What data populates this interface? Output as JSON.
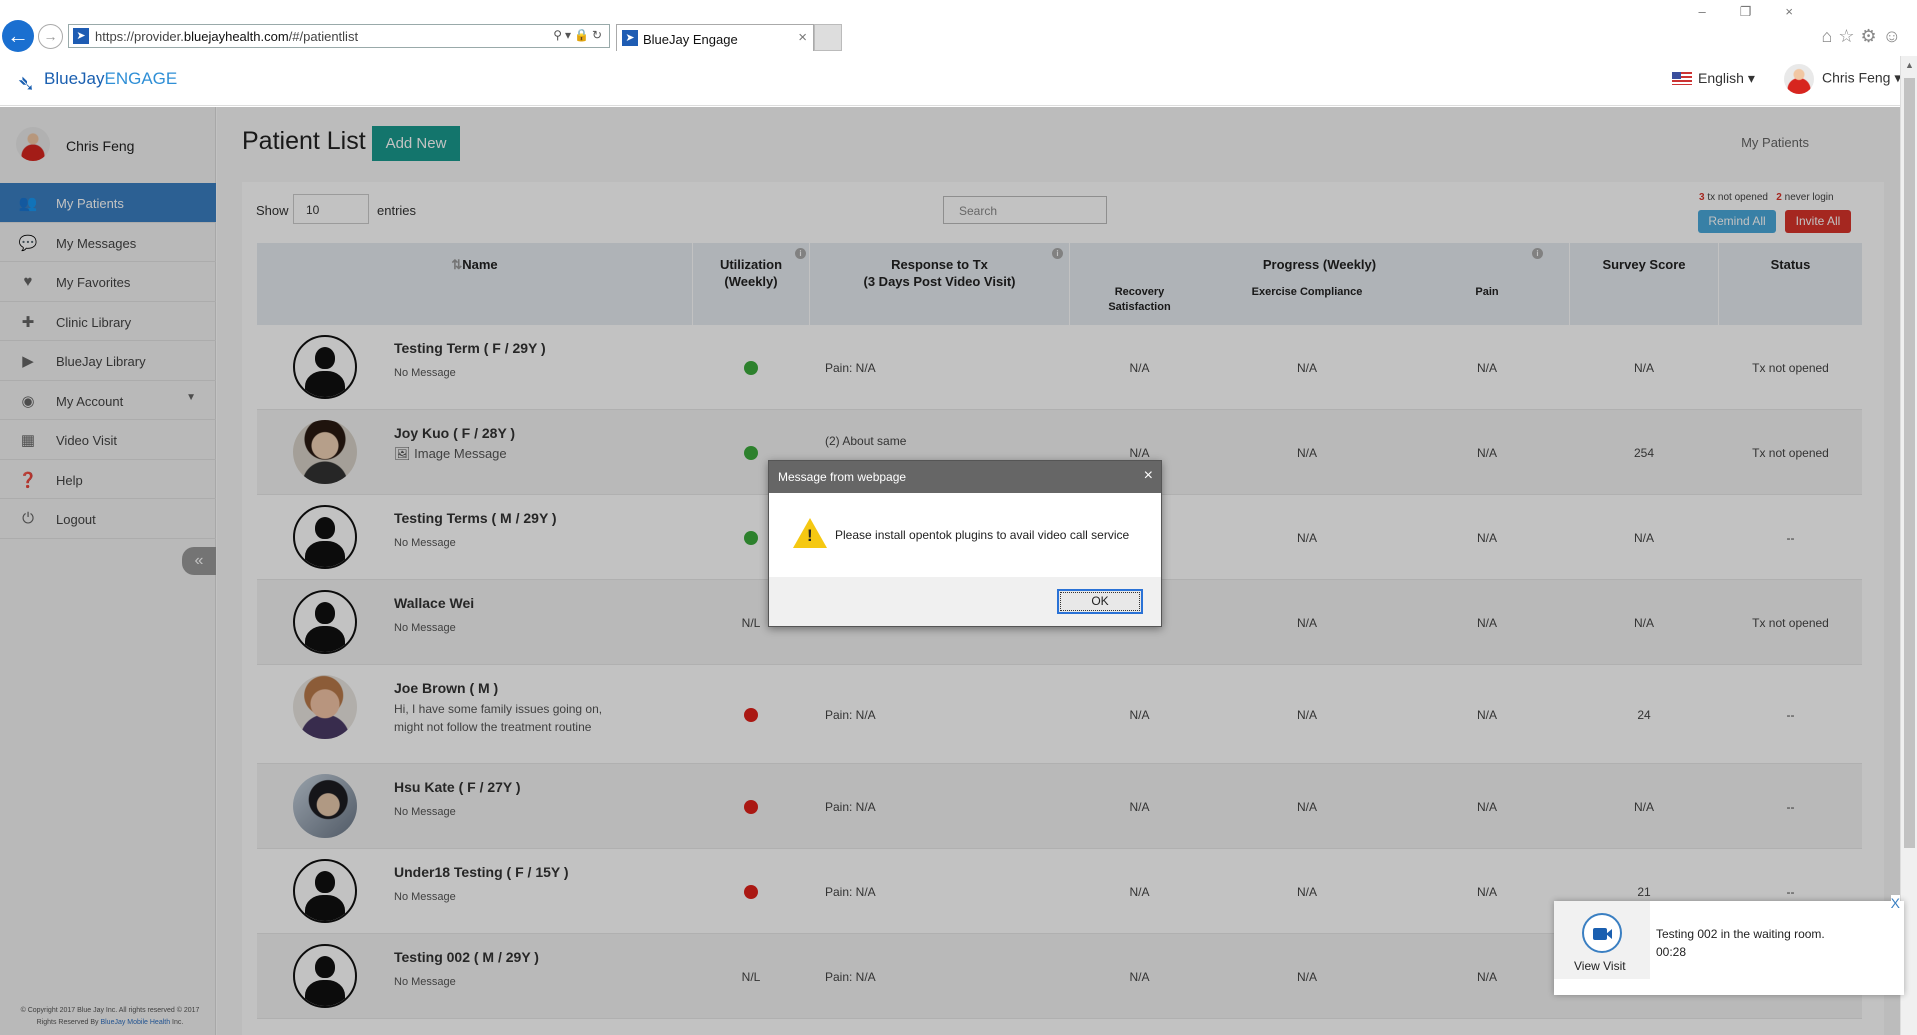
{
  "browser": {
    "url_prefix": "https://provider.",
    "url_domain": "bluejayhealth.com",
    "url_suffix": "/#/patientlist",
    "tab_title": "BlueJay Engage"
  },
  "header": {
    "logo_brand": "BlueJay",
    "logo_product": "ENGAGE",
    "language": "English",
    "user_name": "Chris Feng"
  },
  "sidebar": {
    "user_name": "Chris Feng",
    "items": [
      {
        "label": "My Patients",
        "icon": "users-icon"
      },
      {
        "label": "My Messages",
        "icon": "chat-icon"
      },
      {
        "label": "My Favorites",
        "icon": "heart-icon"
      },
      {
        "label": "Clinic Library",
        "icon": "medical-bag-icon"
      },
      {
        "label": "BlueJay Library",
        "icon": "play-icon"
      },
      {
        "label": "My Account",
        "icon": "account-icon"
      },
      {
        "label": "Video Visit",
        "icon": "calendar-icon"
      },
      {
        "label": "Help",
        "icon": "help-icon"
      },
      {
        "label": "Logout",
        "icon": "power-icon"
      }
    ],
    "collapse_glyph": "«",
    "copyright_line1": "© Copyright 2017 Blue Jay Inc. All rights reserved © 2017",
    "copyright_line2_pre": "Rights Reserved By ",
    "copyright_link": "BlueJay Mobile Health",
    "copyright_line2_post": " Inc."
  },
  "main": {
    "title": "Patient List",
    "add_new": "Add New",
    "breadcrumb": "My Patients",
    "show_label": "Show",
    "show_value": "10",
    "entries_label": "entries",
    "search_placeholder": "Search",
    "tx_count": "3",
    "tx_label": " tx not opened",
    "login_count": "2",
    "login_label": " never login",
    "remind_all": "Remind All",
    "invite_all": "Invite All"
  },
  "table": {
    "headers": {
      "name": "Name",
      "utilization_1": "Utilization",
      "utilization_2": "(Weekly)",
      "response_1": "Response to Tx",
      "response_2": "(3 Days Post Video Visit)",
      "progress": "Progress (Weekly)",
      "recovery_1": "Recovery",
      "recovery_2": "Satisfaction",
      "exercise": "Exercise Compliance",
      "pain": "Pain",
      "survey": "Survey Score",
      "status": "Status"
    },
    "rows": [
      {
        "name": "Testing Term ( F / 29Y )",
        "msg": "No Message",
        "util": "green",
        "response": "Pain: N/A",
        "recovery": "N/A",
        "exercise": "N/A",
        "pain": "N/A",
        "survey": "N/A",
        "status": "Tx not opened"
      },
      {
        "name": "Joy Kuo ( F / 28Y )",
        "msg": "Image Message",
        "util": "green",
        "response": "(2) About same",
        "recovery": "N/A",
        "exercise": "N/A",
        "pain": "N/A",
        "survey": "254",
        "status": "Tx not opened"
      },
      {
        "name": "Testing Terms ( M / 29Y )",
        "msg": "No Message",
        "util": "green",
        "response": "",
        "recovery": "",
        "exercise": "N/A",
        "pain": "N/A",
        "survey": "N/A",
        "status": "--"
      },
      {
        "name": "Wallace Wei",
        "msg": "No Message",
        "util": "N/L",
        "response": "",
        "recovery": "",
        "exercise": "N/A",
        "pain": "N/A",
        "survey": "N/A",
        "status": "Tx not opened"
      },
      {
        "name": "Joe Brown ( M )",
        "msg": "Hi, I have some family issues going on, might not follow the treatment routine",
        "util": "red",
        "response": "Pain: N/A",
        "recovery": "N/A",
        "exercise": "N/A",
        "pain": "N/A",
        "survey": "24",
        "status": "--"
      },
      {
        "name": "Hsu Kate ( F / 27Y )",
        "msg": "No Message",
        "util": "red",
        "response": "Pain: N/A",
        "recovery": "N/A",
        "exercise": "N/A",
        "pain": "N/A",
        "survey": "N/A",
        "status": "--"
      },
      {
        "name": "Under18 Testing ( F / 15Y )",
        "msg": "No Message",
        "util": "red",
        "response": "Pain: N/A",
        "recovery": "N/A",
        "exercise": "N/A",
        "pain": "N/A",
        "survey": "21",
        "status": "--"
      },
      {
        "name": "Testing 002 ( M / 29Y )",
        "msg": "No Message",
        "util": "N/L",
        "response": "Pain: N/A",
        "recovery": "N/A",
        "exercise": "N/A",
        "pain": "N/A",
        "survey": "",
        "status": ""
      }
    ]
  },
  "dialog": {
    "title": "Message from webpage",
    "message": "Please install opentok plugins to avail video call service",
    "ok": "OK"
  },
  "toast": {
    "view_visit": "View Visit",
    "message_line1": "Testing 002 in the waiting room.",
    "message_line2": "00:28",
    "close": "X"
  },
  "colors": {
    "primary_blue": "#3a7fc2",
    "teal": "#1a9a8e",
    "danger_red": "#d9342b",
    "info_blue": "#4aa9da"
  }
}
